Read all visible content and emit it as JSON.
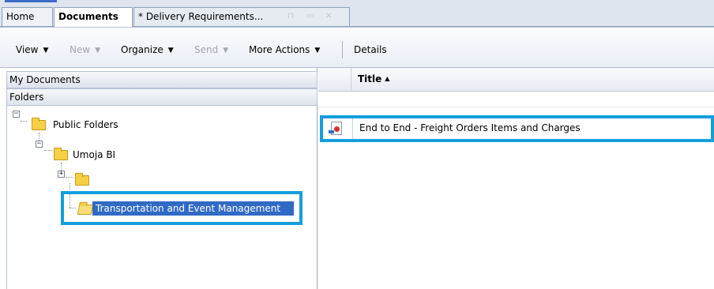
{
  "tabs": [
    {
      "label": "Home",
      "active": false
    },
    {
      "label": "Documents",
      "active": true
    },
    {
      "label": "* Delivery Requirements...",
      "active": false
    }
  ],
  "toolbar": {
    "view": "View",
    "new": "New",
    "organize": "Organize",
    "send": "Send",
    "more_actions": "More Actions",
    "details": "Details",
    "arrow": "▼"
  },
  "left_pane": {
    "my_documents": "My Documents",
    "folders": "Folders",
    "tree": {
      "public_folders": "Public Folders",
      "umoja_bi": "Umoja BI",
      "unnamed_folder": "",
      "selected": "Transportation and Event Management",
      "expanded_symbol": "−",
      "collapsed_symbol": "+"
    }
  },
  "right_pane": {
    "column_title": "Title",
    "sort_indicator": "▲",
    "documents": [
      {
        "title": "End to End - Freight Orders Items and Charges"
      }
    ]
  },
  "colors": {
    "highlight_box": "#149fdc",
    "selection": "#316ac5",
    "folder": "#f6cf47"
  }
}
